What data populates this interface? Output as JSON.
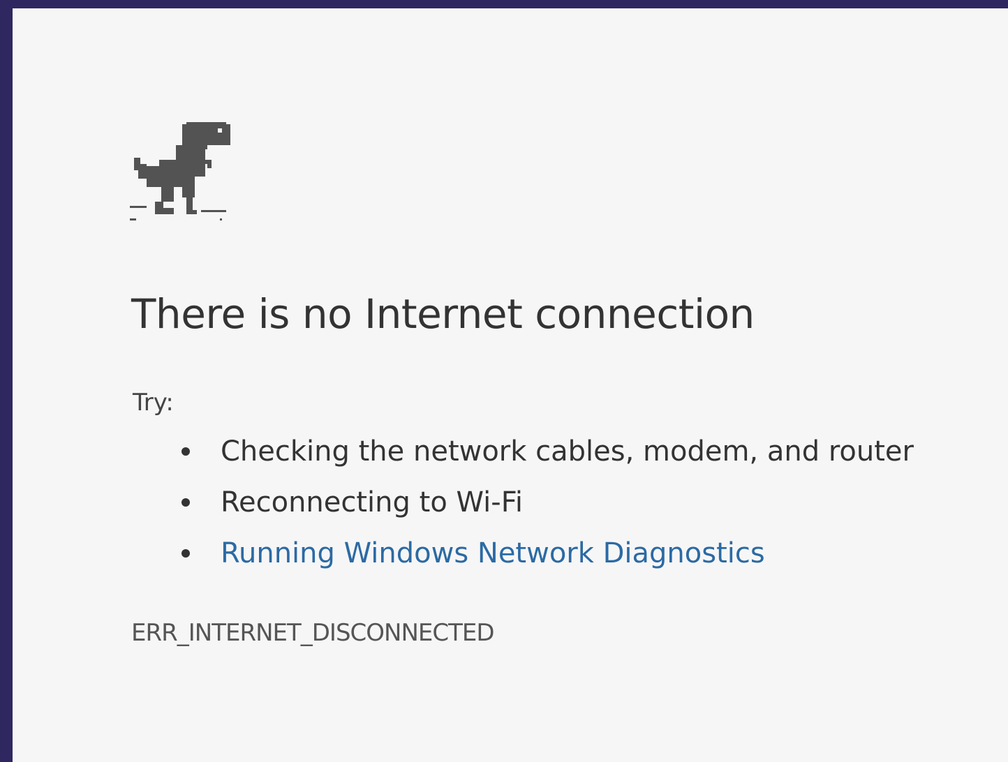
{
  "page": {
    "background_color": "#2f2860",
    "panel_color": "#f6f6f6"
  },
  "icon": {
    "name": "offline-dinosaur-icon",
    "color": "#535353"
  },
  "error": {
    "title": "There is no Internet connection",
    "try_label": "Try:",
    "suggestions": [
      "Checking the network cables, modem, and router",
      "Reconnecting to Wi-Fi"
    ],
    "diagnostics_link": "Running Windows Network Diagnostics",
    "link_color": "#2b6aa4",
    "code": "ERR_INTERNET_DISCONNECTED"
  }
}
